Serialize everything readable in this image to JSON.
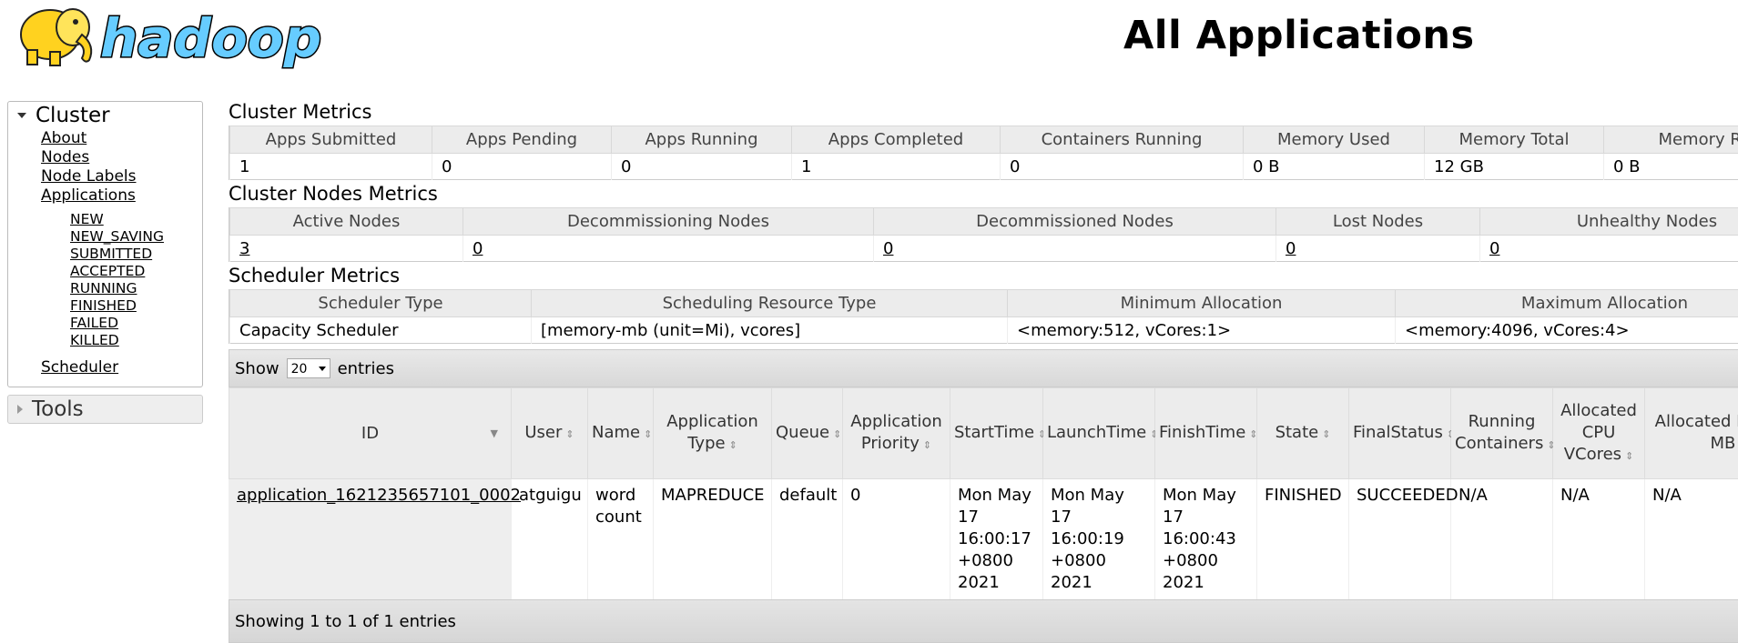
{
  "header": {
    "logo_text": "hadoop",
    "title": "All Applications"
  },
  "nav": {
    "cluster_label": "Cluster",
    "cluster_links": [
      "About",
      "Nodes",
      "Node Labels",
      "Applications"
    ],
    "app_states": [
      "NEW",
      "NEW_SAVING",
      "SUBMITTED",
      "ACCEPTED",
      "RUNNING",
      "FINISHED",
      "FAILED",
      "KILLED"
    ],
    "scheduler_link": "Scheduler",
    "tools_label": "Tools"
  },
  "cluster_metrics": {
    "title": "Cluster Metrics",
    "headers": [
      "Apps Submitted",
      "Apps Pending",
      "Apps Running",
      "Apps Completed",
      "Containers Running",
      "Memory Used",
      "Memory Total",
      "Memory Res"
    ],
    "values": [
      "1",
      "0",
      "0",
      "1",
      "0",
      "0 B",
      "12 GB",
      "0 B"
    ]
  },
  "node_metrics": {
    "title": "Cluster Nodes Metrics",
    "headers": [
      "Active Nodes",
      "Decommissioning Nodes",
      "Decommissioned Nodes",
      "Lost Nodes",
      "Unhealthy Nodes"
    ],
    "values": [
      "3",
      "0",
      "0",
      "0",
      "0"
    ]
  },
  "scheduler_metrics": {
    "title": "Scheduler Metrics",
    "headers": [
      "Scheduler Type",
      "Scheduling Resource Type",
      "Minimum Allocation",
      "Maximum Allocation"
    ],
    "values": [
      "Capacity Scheduler",
      "[memory-mb (unit=Mi), vcores]",
      "<memory:512, vCores:1>",
      "<memory:4096, vCores:4>"
    ]
  },
  "apps_table": {
    "show_label": "Show",
    "page_size": "20",
    "entries_label": "entries",
    "headers": [
      "ID",
      "User",
      "Name",
      "Application Type",
      "Queue",
      "Application Priority",
      "StartTime",
      "LaunchTime",
      "FinishTime",
      "State",
      "FinalStatus",
      "Running Containers",
      "Allocated CPU VCores",
      "Allocated Memory MB"
    ],
    "rows": [
      [
        "application_1621235657101_0002",
        "atguigu",
        "word count",
        "MAPREDUCE",
        "default",
        "0",
        "Mon May 17 16:00:17 +0800 2021",
        "Mon May 17 16:00:19 +0800 2021",
        "Mon May 17 16:00:43 +0800 2021",
        "FINISHED",
        "SUCCEEDED",
        "N/A",
        "N/A",
        "N/A"
      ]
    ],
    "footer": "Showing 1 to 1 of 1 entries"
  },
  "colors": {
    "header_bg": "#ececec",
    "toolbar_bg": "#dcdcdc",
    "logo_yellow": "#ffd21f",
    "logo_blue": "#66ccff"
  }
}
